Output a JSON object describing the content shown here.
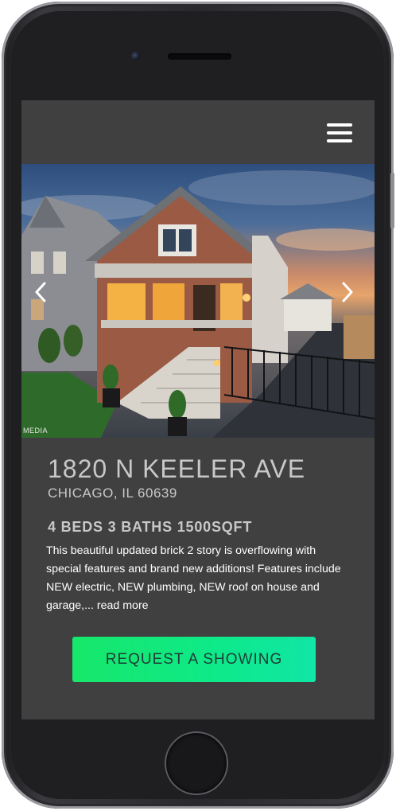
{
  "listing": {
    "address": "1820 N KEELER AVE",
    "city_state_zip": "CHICAGO, IL 60639",
    "specs": "4 BEDS 3 BATHS 1500SQFT",
    "description": "This beautiful updated brick 2 story is overflowing with special features and brand new additions! Features include NEW electric, NEW plumbing, NEW roof on house and garage,...",
    "read_more_label": "read more",
    "cta_label": "REQUEST A SHOWING",
    "photo_watermark": "MEDIA"
  },
  "icons": {
    "menu": "hamburger-menu-icon",
    "prev": "chevron-left-icon",
    "next": "chevron-right-icon"
  },
  "colors": {
    "screen_bg": "#404040",
    "text_primary": "#c8c8c8",
    "cta_gradient_start": "#17e86a",
    "cta_gradient_end": "#10e6a6"
  }
}
